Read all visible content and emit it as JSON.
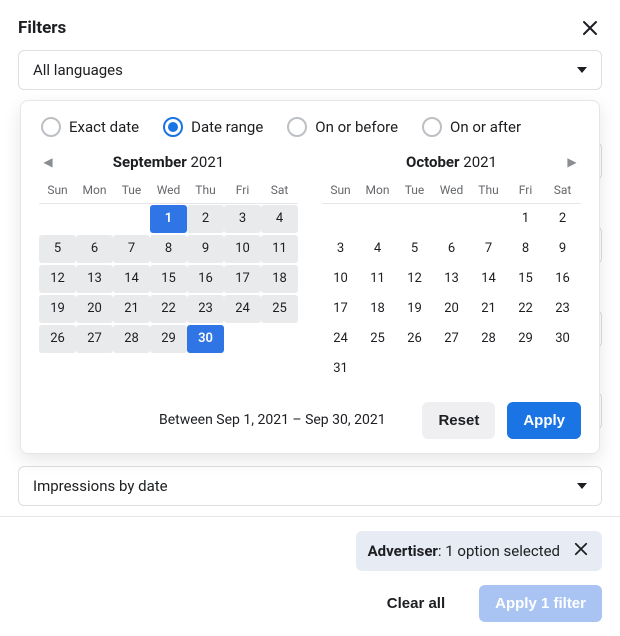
{
  "header": {
    "title": "Filters"
  },
  "dropdowns": {
    "languages": "All languages",
    "impressions": "Impressions by date"
  },
  "date_picker": {
    "modes": {
      "exact": "Exact date",
      "range": "Date range",
      "on_or_before": "On or before",
      "on_or_after": "On or after",
      "selected": "range"
    },
    "dow": [
      "Sun",
      "Mon",
      "Tue",
      "Wed",
      "Thu",
      "Fri",
      "Sat"
    ],
    "left": {
      "month_name": "September",
      "year": "2021",
      "first_dow": 3,
      "days": 30,
      "range_start": 1,
      "range_end": 30
    },
    "right": {
      "month_name": "October",
      "year": "2021",
      "first_dow": 5,
      "days": 31,
      "range_start": null,
      "range_end": null
    },
    "summary": "Between Sep 1, 2021 – Sep 30, 2021",
    "reset_label": "Reset",
    "apply_label": "Apply"
  },
  "footer": {
    "chip_label": "Advertiser",
    "chip_text": ": 1 option selected",
    "clear_all": "Clear all",
    "apply_filters": "Apply 1 filter"
  }
}
